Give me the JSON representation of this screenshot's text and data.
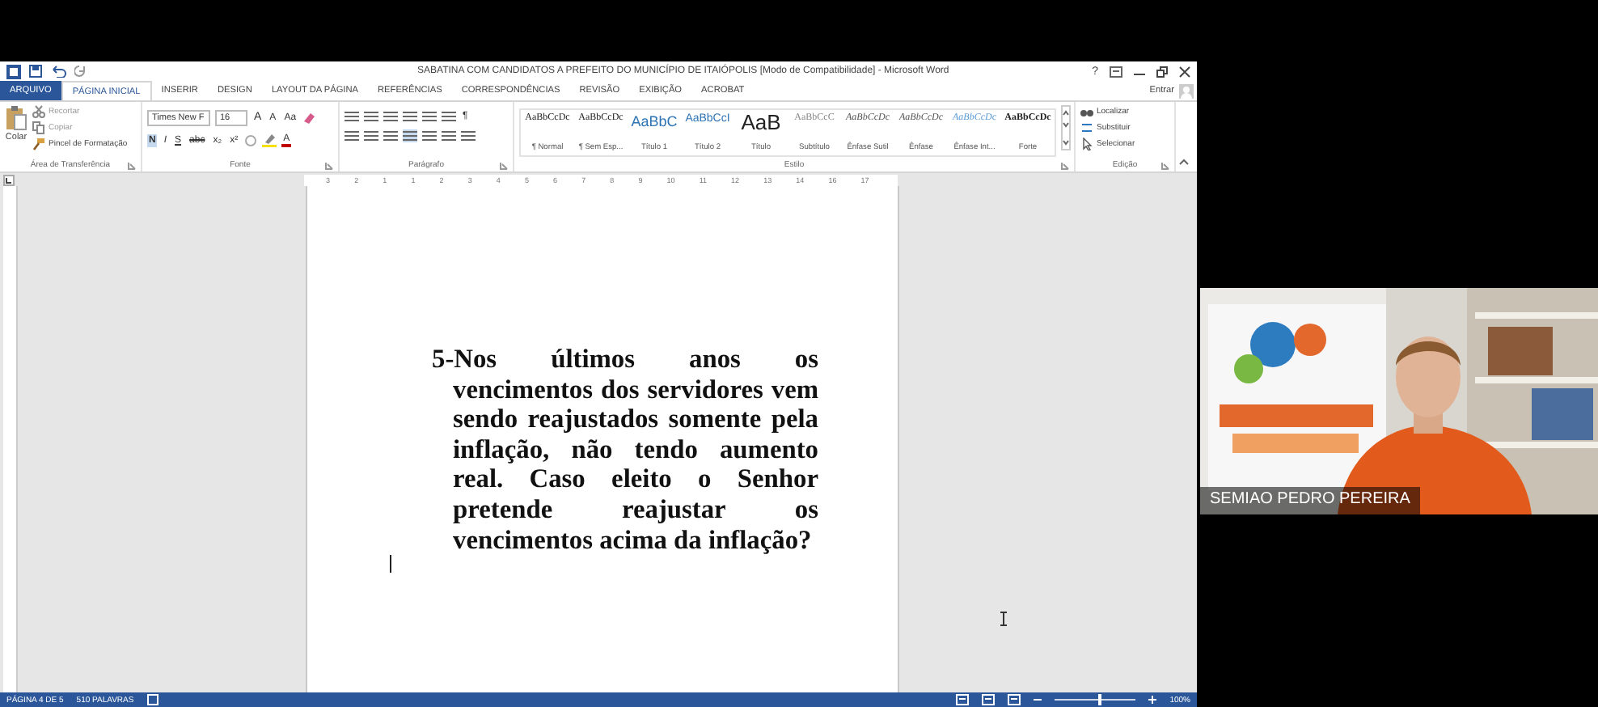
{
  "word": {
    "title": "SABATINA COM CANDIDATOS A PREFEITO DO MUNICÍPIO DE ITAIÓPOLIS [Modo de Compatibilidade] - Microsoft Word",
    "help": "?",
    "sign_in": "Entrar",
    "tabs": [
      {
        "label": "ARQUIVO",
        "kind": "file",
        "selected": false
      },
      {
        "label": "PÁGINA INICIAL",
        "kind": "tab",
        "selected": true
      },
      {
        "label": "INSERIR",
        "kind": "tab",
        "selected": false
      },
      {
        "label": "DESIGN",
        "kind": "tab",
        "selected": false
      },
      {
        "label": "LAYOUT DA PÁGINA",
        "kind": "tab",
        "selected": false
      },
      {
        "label": "REFERÊNCIAS",
        "kind": "tab",
        "selected": false
      },
      {
        "label": "CORRESPONDÊNCIAS",
        "kind": "tab",
        "selected": false
      },
      {
        "label": "REVISÃO",
        "kind": "tab",
        "selected": false
      },
      {
        "label": "EXIBIÇÃO",
        "kind": "tab",
        "selected": false
      },
      {
        "label": "ACROBAT",
        "kind": "tab",
        "selected": false
      }
    ],
    "clipboard": {
      "paste": "Colar",
      "cut": "Recortar",
      "copy": "Copiar",
      "format_painter": "Pincel de Formatação",
      "label": "Área de Transferência"
    },
    "font": {
      "name": "Times New F",
      "size": "16",
      "grow": "A",
      "shrink": "A",
      "case": "Aa",
      "bold": "N",
      "italic": "I",
      "underline": "S",
      "strike": "abc",
      "sub": "x₂",
      "sup": "x²",
      "font_color": "A",
      "label": "Fonte"
    },
    "paragraph": {
      "label": "Parágrafo",
      "pilcrow": "¶"
    },
    "styles": {
      "label": "Estilo",
      "items": [
        {
          "sample": "AaBbCcDc",
          "name": "¶ Normal",
          "kind": "normal"
        },
        {
          "sample": "AaBbCcDc",
          "name": "¶ Sem Esp...",
          "kind": "normal"
        },
        {
          "sample": "AaBbC",
          "name": "Título 1",
          "kind": "heading"
        },
        {
          "sample": "AaBbCcI",
          "name": "Título 2",
          "kind": "heading2"
        },
        {
          "sample": "AaB",
          "name": "Título",
          "kind": "title"
        },
        {
          "sample": "AaBbCcC",
          "name": "Subtítulo",
          "kind": "subtle"
        },
        {
          "sample": "AaBbCcDc",
          "name": "Ênfase Sutil",
          "kind": "italic"
        },
        {
          "sample": "AaBbCcDc",
          "name": "Ênfase",
          "kind": "italic"
        },
        {
          "sample": "AaBbCcDc",
          "name": "Ênfase Int...",
          "kind": "accent"
        },
        {
          "sample": "AaBbCcDc",
          "name": "Forte",
          "kind": "strong"
        }
      ]
    },
    "editing": {
      "find": "Localizar",
      "replace": "Substituir",
      "select": "Selecionar",
      "label": "Edição"
    },
    "ruler": [
      "3",
      "2",
      "1",
      "1",
      "2",
      "3",
      "4",
      "5",
      "6",
      "7",
      "8",
      "9",
      "10",
      "11",
      "12",
      "13",
      "14",
      "16",
      "17"
    ],
    "document": {
      "number": "5-",
      "text": "Nos últimos anos os vencimentos dos servidores vem sendo reajustados somente pela inflação, não tendo aumento real. Caso eleito o Senhor pretende reajustar os vencimentos acima da inflação?"
    },
    "status_bar": {
      "page": "PÁGINA 4 DE 5",
      "words": "510 PALAVRAS",
      "zoom": {
        "level": 0.55
      },
      "zoom_label": "100%"
    }
  },
  "video": {
    "participant": "SEMIAO PEDRO PEREIRA"
  }
}
